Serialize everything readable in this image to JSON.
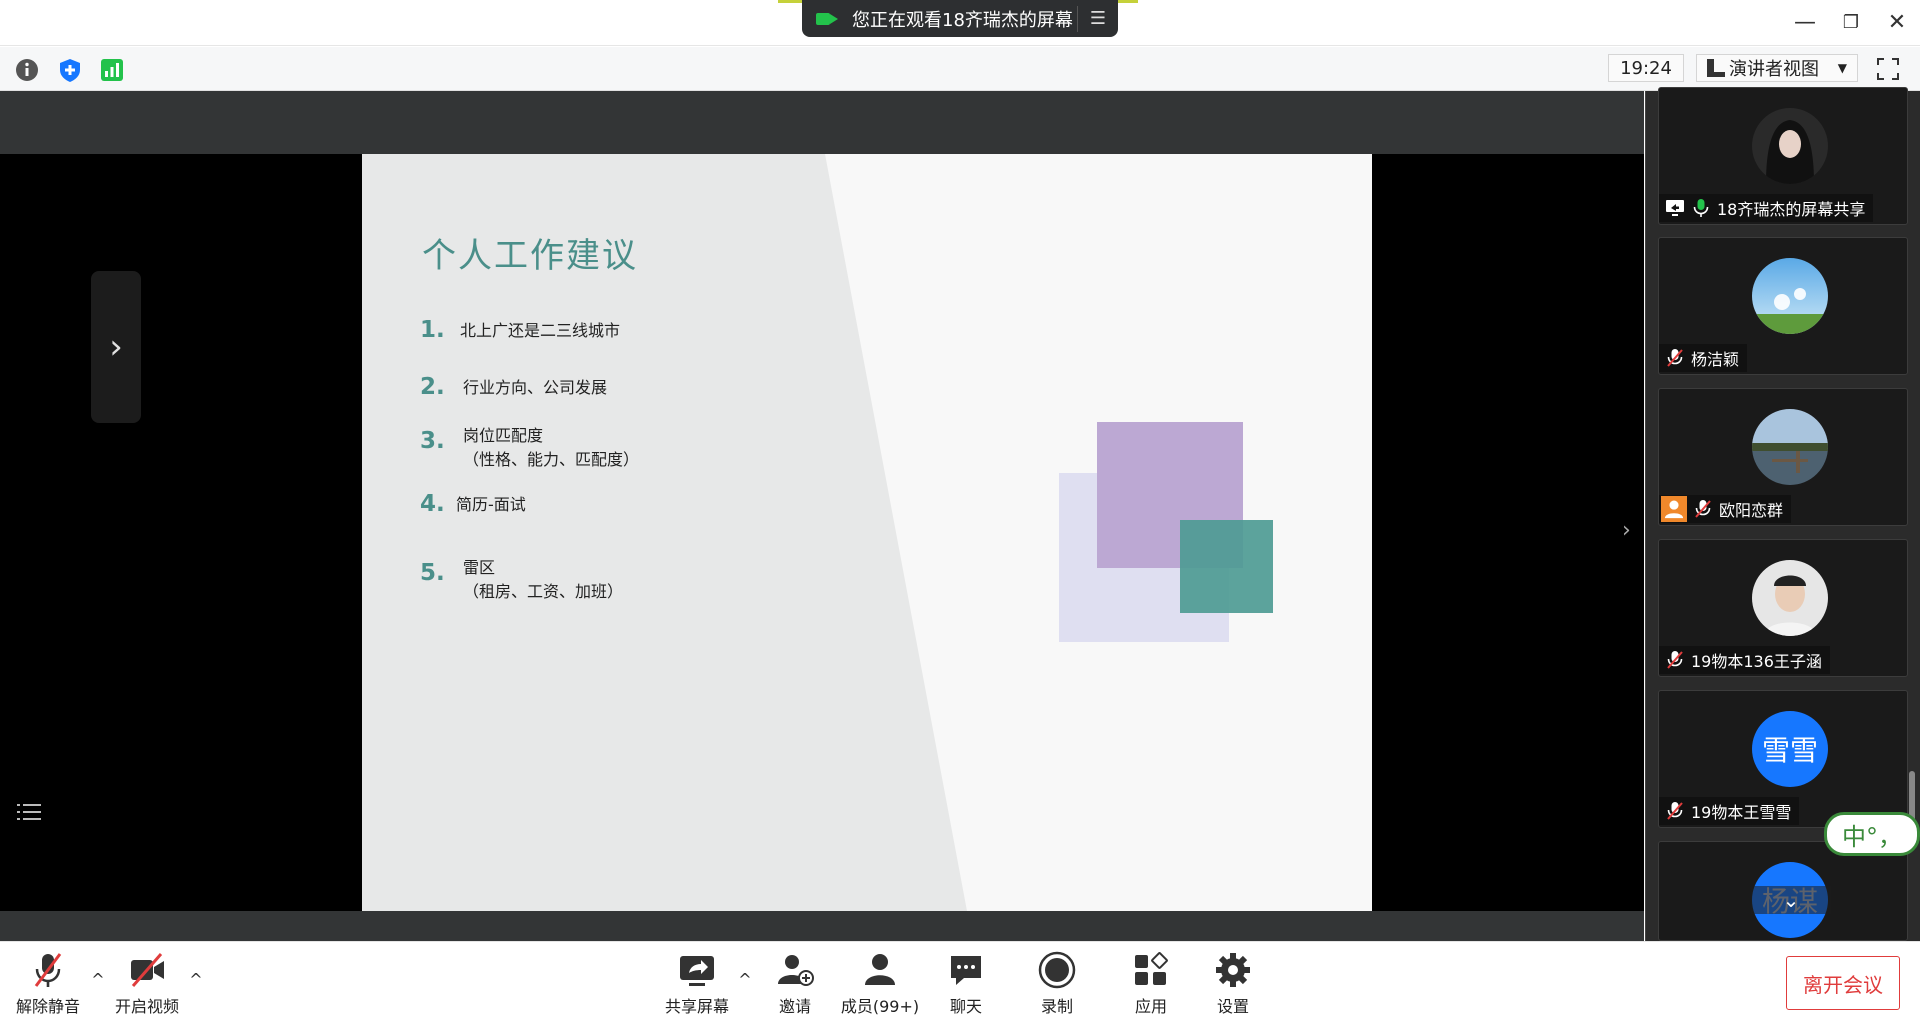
{
  "banner": {
    "text": "您正在观看18齐瑞杰的屏幕"
  },
  "toolbar": {
    "time": "19:24",
    "view_mode": "演讲者视图"
  },
  "slide": {
    "title": "个人工作建议",
    "items": [
      {
        "num": "1.",
        "line1": "北上广还是二三线城市",
        "line2": ""
      },
      {
        "num": "2.",
        "line1": "行业方向、公司发展",
        "line2": ""
      },
      {
        "num": "3.",
        "line1": "岗位匹配度",
        "line2": "（性格、能力、匹配度）"
      },
      {
        "num": "4.",
        "line1": "简历-面试",
        "line2": ""
      },
      {
        "num": "5.",
        "line1": "雷区",
        "line2": "（租房、工资、加班）"
      }
    ]
  },
  "participants": [
    {
      "name": "18齐瑞杰的屏幕共享",
      "avatar": "photo-woman"
    },
    {
      "name": "杨洁颖",
      "avatar": "photo-dandelion"
    },
    {
      "name": "欧阳恋群",
      "avatar": "photo-lake"
    },
    {
      "name": "19物本136王子涵",
      "avatar": "photo-boy"
    },
    {
      "name": "19物本王雪雪",
      "avatar_text": "雪雪"
    },
    {
      "name": "",
      "avatar_text": "杨谋"
    }
  ],
  "ime": {
    "text": "中°，"
  },
  "bottombar": {
    "unmute": "解除静音",
    "video": "开启视频",
    "share": "共享屏幕",
    "invite": "邀请",
    "members": "成员(99+)",
    "chat": "聊天",
    "record": "录制",
    "apps": "应用",
    "settings": "设置",
    "leave": "离开会议"
  },
  "colors": {
    "slide_accent": "#4a8f8a",
    "mic_on": "#23c24b",
    "avatar_blue": "#1677ff",
    "leave": "#e03c3c"
  }
}
